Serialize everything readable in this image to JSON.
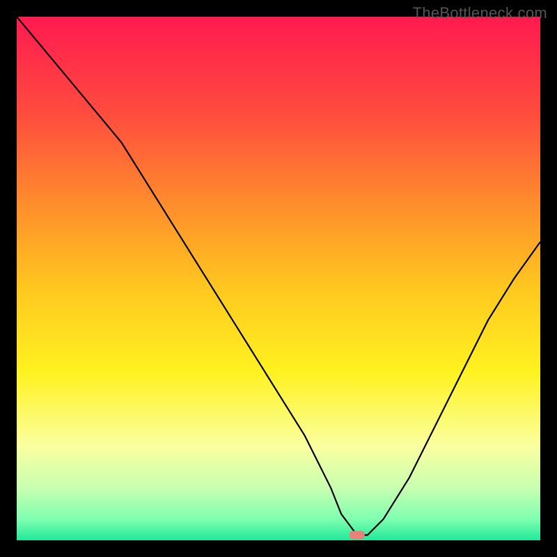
{
  "watermark": "TheBottleneck.com",
  "chart_data": {
    "type": "line",
    "title": "",
    "xlabel": "",
    "ylabel": "",
    "xlim": [
      0,
      100
    ],
    "ylim": [
      0,
      100
    ],
    "grid": false,
    "legend": false,
    "series": [
      {
        "name": "bottleneck-curve",
        "color": "#000000",
        "x": [
          0,
          10,
          20,
          30,
          40,
          50,
          55,
          60,
          62,
          65,
          67,
          70,
          75,
          80,
          85,
          90,
          95,
          100
        ],
        "values": [
          100,
          88,
          76,
          60,
          44,
          28,
          20,
          10,
          5,
          1,
          1,
          4,
          12,
          22,
          32,
          42,
          50,
          57
        ]
      }
    ],
    "marker": {
      "name": "optimal-point",
      "x": 65,
      "y": 1,
      "color": "#e8817a",
      "shape": "rounded-rect"
    },
    "background_gradient": {
      "type": "vertical",
      "stops": [
        {
          "offset": 0.0,
          "color": "#ff1a4f"
        },
        {
          "offset": 0.18,
          "color": "#ff4a3f"
        },
        {
          "offset": 0.35,
          "color": "#ff8a2d"
        },
        {
          "offset": 0.52,
          "color": "#ffc81f"
        },
        {
          "offset": 0.68,
          "color": "#fff220"
        },
        {
          "offset": 0.82,
          "color": "#fbffa0"
        },
        {
          "offset": 0.9,
          "color": "#c8ffb0"
        },
        {
          "offset": 0.96,
          "color": "#7fffb0"
        },
        {
          "offset": 1.0,
          "color": "#20e89a"
        }
      ]
    }
  }
}
